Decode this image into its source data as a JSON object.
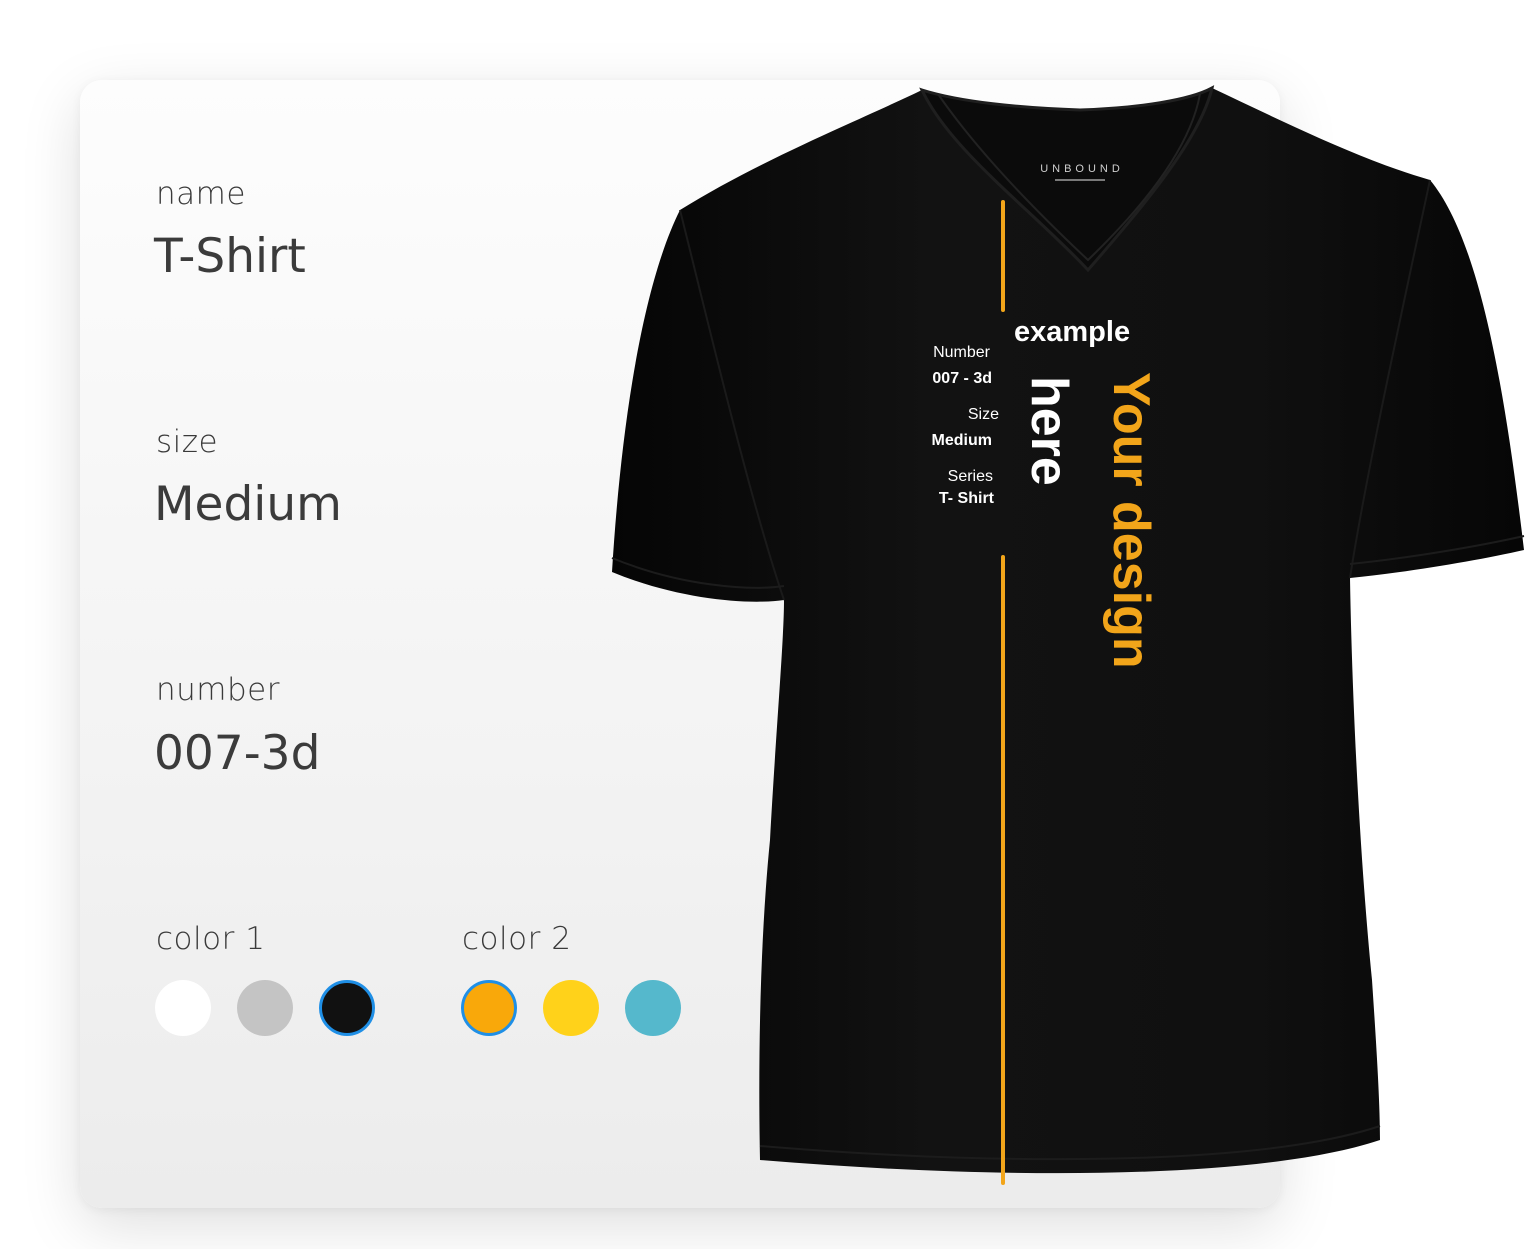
{
  "form": {
    "name": {
      "label": "name",
      "value": "T-Shirt"
    },
    "size": {
      "label": "size",
      "value": "Medium"
    },
    "number": {
      "label": "number",
      "value": "007-3d"
    },
    "color1": {
      "label": "color 1",
      "swatches": [
        {
          "color": "#ffffff",
          "selected": false
        },
        {
          "color": "#c4c4c4",
          "selected": false
        },
        {
          "color": "#111111",
          "selected": true
        }
      ]
    },
    "color2": {
      "label": "color 2",
      "swatches": [
        {
          "color": "#f9a80a",
          "selected": true
        },
        {
          "color": "#ffd21a",
          "selected": false
        },
        {
          "color": "#55b8cc",
          "selected": false
        }
      ]
    }
  },
  "preview": {
    "brand": "UNBOUND",
    "number_label": "Number",
    "number_value": "007 - 3d",
    "size_label": "Size",
    "size_value": "Medium",
    "series_label": "Series",
    "series_value": "T- Shirt",
    "headline_top": "example",
    "headline_white": "here",
    "headline_accent": "Your design",
    "accent_color": "#f2a51a",
    "shirt_color": "#111111"
  }
}
